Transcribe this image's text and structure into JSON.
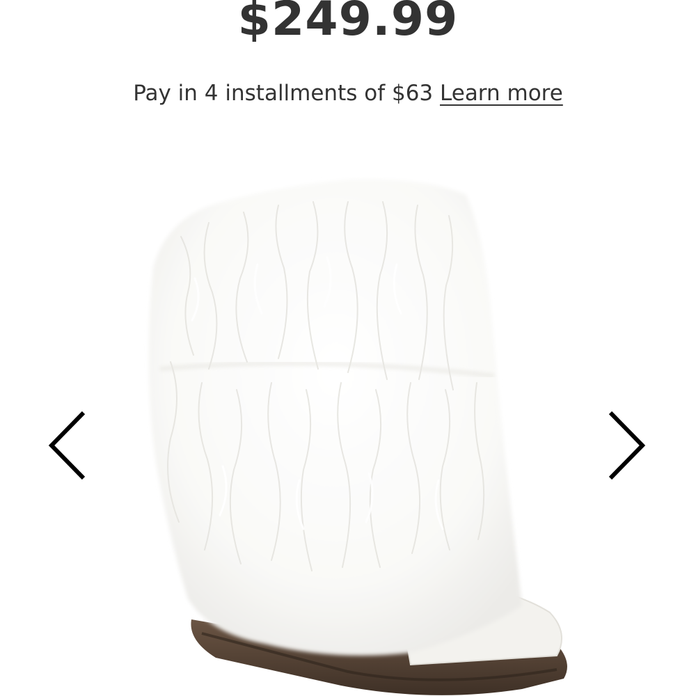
{
  "product": {
    "price": "$249.99",
    "installments_text": "Pay in 4 installments of $63",
    "learn_more_label": "Learn more",
    "image_icon": "fluffy-white-fur-boot-image"
  },
  "gallery": {
    "prev_icon": "chevron-left-icon",
    "next_icon": "chevron-right-icon"
  },
  "colors": {
    "text": "#333333",
    "background": "#ffffff",
    "fur": "#f7f7f5",
    "sole": "#5a4636"
  }
}
